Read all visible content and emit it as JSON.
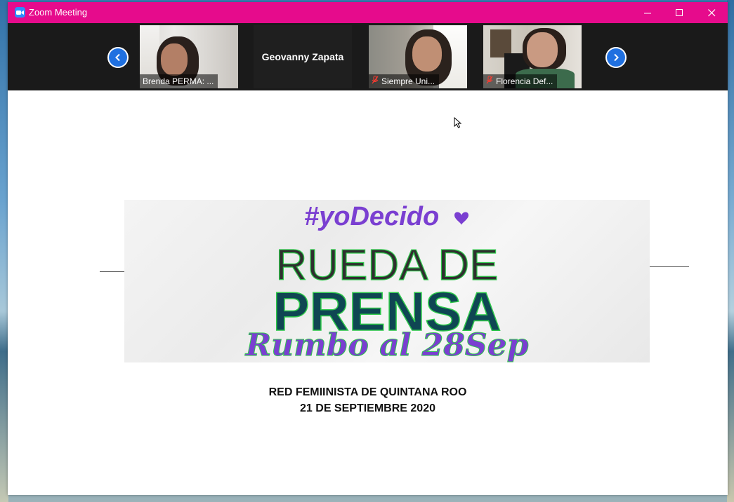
{
  "window": {
    "title": "Zoom Meeting",
    "controls": {
      "minimize": "minimize",
      "maximize": "maximize",
      "close": "close"
    }
  },
  "participants": [
    {
      "name": "Brenda PERMA: ...",
      "video": true,
      "muted": false
    },
    {
      "name": "Geovanny Zapata",
      "video": false,
      "muted": false
    },
    {
      "name": "Siempre Uni...",
      "video": true,
      "muted": true
    },
    {
      "name": "Florencia Def...",
      "video": true,
      "muted": true
    }
  ],
  "share": {
    "banner": {
      "hashtag": "#yoDecido",
      "heading_line1": "RUEDA DE",
      "heading_line2": "PRENSA",
      "tagline": "Rumbo al 28Sep"
    },
    "caption_line1": "RED FEMIINISTA DE QUINTANA ROO",
    "caption_line2": "21 DE SEPTIEMBRE 2020"
  },
  "colors": {
    "titlebar": "#e60b8c",
    "purple": "#7a3fd1",
    "green": "#2ec84a",
    "teal": "#0f4653",
    "nav_blue": "#1f70e0"
  },
  "icons": {
    "app": "zoom-video-camera-icon",
    "prev": "chevron-left-icon",
    "next": "chevron-right-icon",
    "mic_off": "mic-off-icon"
  }
}
